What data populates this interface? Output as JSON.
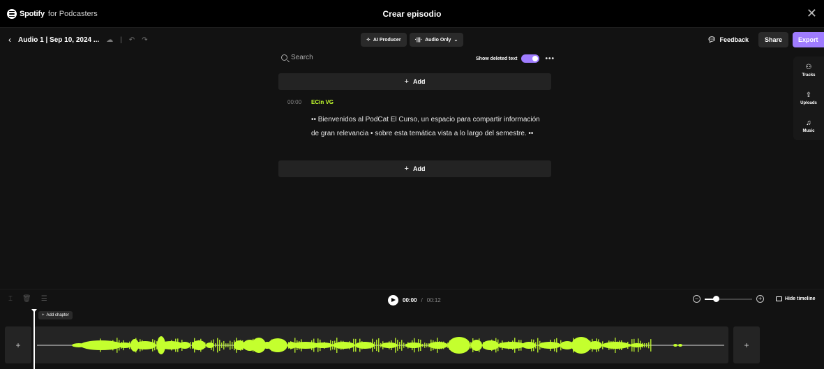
{
  "window": {
    "brand": "Spotify",
    "brand_sub": "for Podcasters",
    "title": "Crear episodio"
  },
  "toolbar": {
    "episode": "Audio 1 | Sep 10, 2024 ...",
    "ai_producer": "AI Producer",
    "audio_mode": "Audio Only",
    "feedback": "Feedback",
    "share": "Share",
    "export": "Export"
  },
  "side_panel": {
    "tracks": "Tracks",
    "uploads": "Uploads",
    "music": "Music"
  },
  "editor": {
    "search_placeholder": "Search",
    "show_deleted": "Show deleted text",
    "show_deleted_on": true,
    "add_label": "Add",
    "segment": {
      "time": "00:00",
      "speaker": "ECin VG",
      "text": "•• Bienvenidos al PodCat El Curso, un espacio para compartir información de gran relevancia • sobre esta temática vista a lo largo del semestre. ••"
    }
  },
  "timeline": {
    "current": "00:00",
    "separator": "/",
    "total": "00:12",
    "hide_timeline": "Hide timeline",
    "add_chapter": "Add chapter",
    "zoom_level": 0.2
  },
  "colors": {
    "accent": "#9f7cff",
    "waveform": "#c4ff2e",
    "speaker": "#c4ff2e"
  }
}
